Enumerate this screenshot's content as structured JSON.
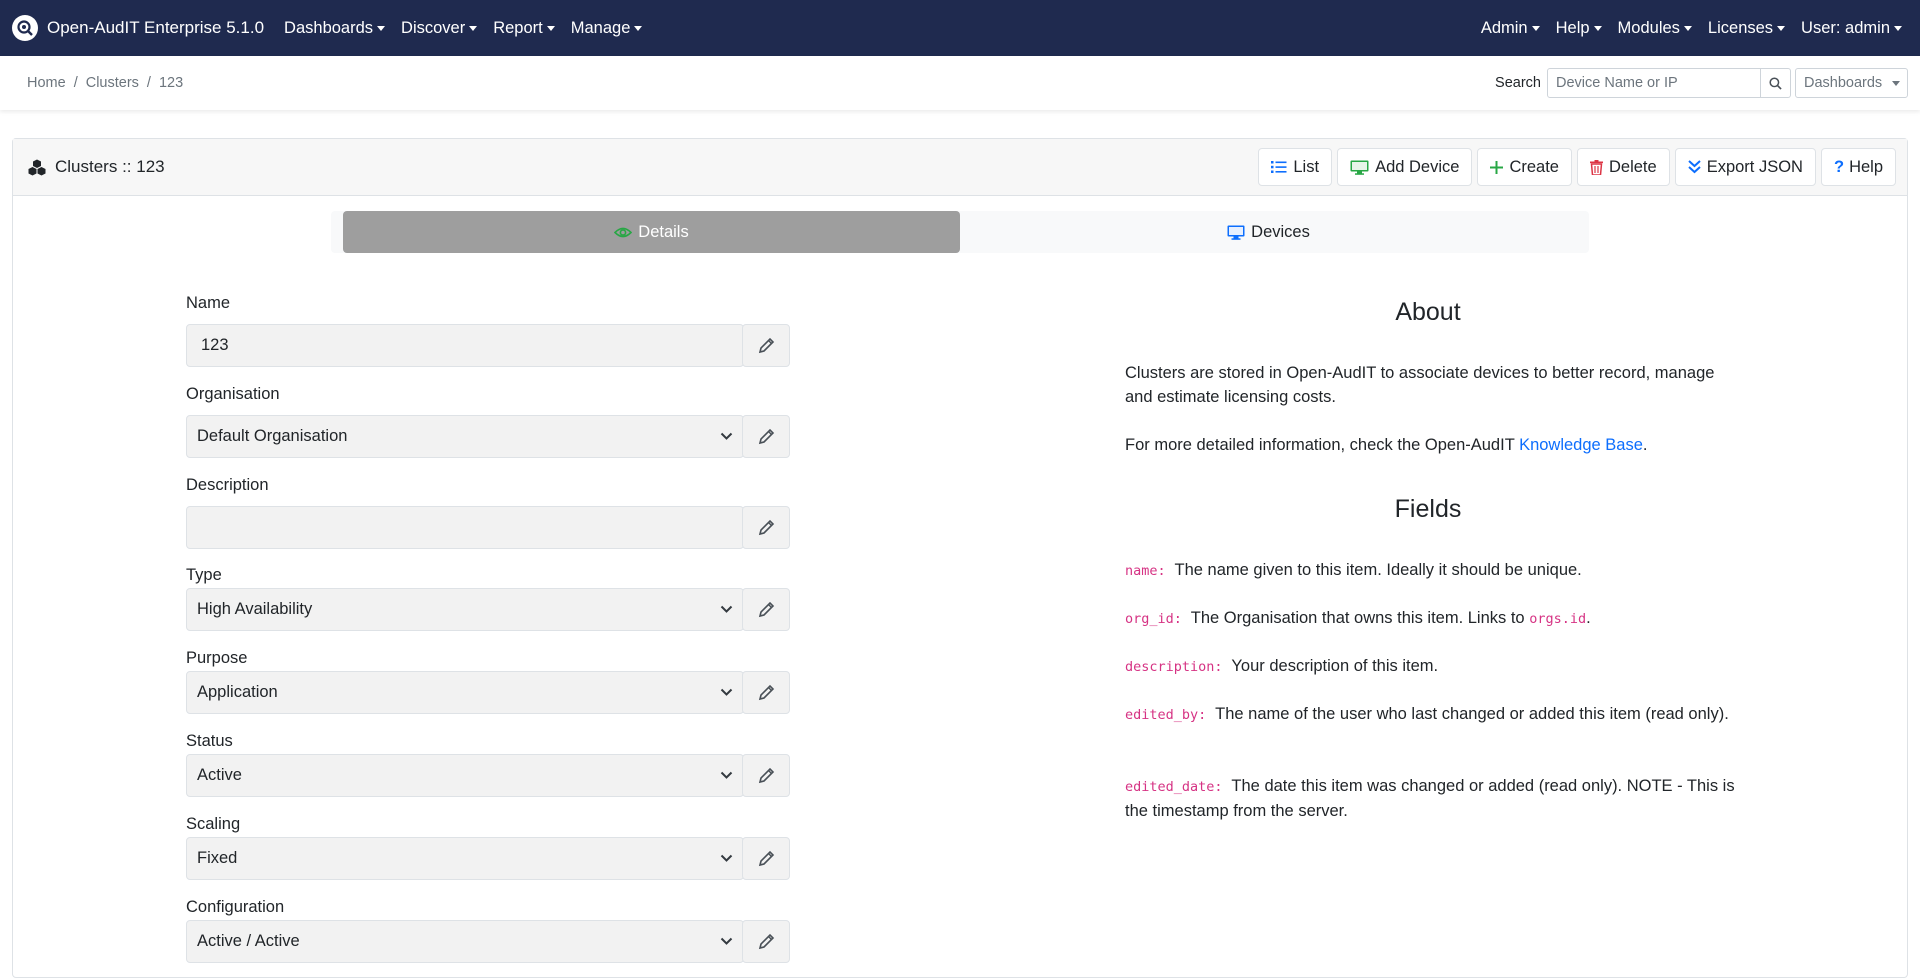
{
  "navbar": {
    "brand": "Open-AudIT Enterprise 5.1.0",
    "left_menu": [
      "Dashboards",
      "Discover",
      "Report",
      "Manage"
    ],
    "right_menu": [
      "Admin",
      "Help",
      "Modules",
      "Licenses",
      "User: admin"
    ],
    "background": "#1f2a4f"
  },
  "breadcrumb": {
    "items": [
      "Home",
      "Clusters",
      "123"
    ]
  },
  "search": {
    "label": "Search",
    "placeholder": "Device Name or IP",
    "dashboards_label": "Dashboards"
  },
  "card": {
    "title": "Clusters :: 123",
    "toolbar": {
      "list": "List",
      "add_device": "Add Device",
      "create": "Create",
      "delete": "Delete",
      "export_json": "Export JSON",
      "help": "Help"
    },
    "tabs": {
      "details": "Details",
      "devices": "Devices"
    }
  },
  "form": {
    "name": {
      "label": "Name",
      "value": "123"
    },
    "organisation": {
      "label": "Organisation",
      "value": "Default Organisation"
    },
    "description": {
      "label": "Description",
      "value": ""
    },
    "type": {
      "label": "Type",
      "value": "High Availability"
    },
    "purpose": {
      "label": "Purpose",
      "value": "Application"
    },
    "status": {
      "label": "Status",
      "value": "Active"
    },
    "scaling": {
      "label": "Scaling",
      "value": "Fixed"
    },
    "configuration": {
      "label": "Configuration",
      "value": "Active / Active"
    }
  },
  "about": {
    "heading": "About",
    "text": "Clusters are stored in Open-AudIT to associate devices to better record, manage and estimate licensing costs.",
    "more_info_prefix": "For more detailed information, check the Open-AudIT ",
    "kb_link": "Knowledge Base",
    "more_info_suffix": ".",
    "fields_heading": "Fields",
    "fields": {
      "name_key": "name:",
      "name_desc": "The name given to this item. Ideally it should be unique.",
      "org_key": "org_id:",
      "org_desc": "The Organisation that owns this item. Links to ",
      "org_link_code": "orgs.id",
      "org_desc_end": ".",
      "desc_key": "description:",
      "desc_desc": "Your description of this item.",
      "edited_by_key": "edited_by:",
      "edited_by_desc": "The name of the user who last changed or added this item (read only).",
      "edited_date_key": "edited_date:",
      "edited_date_desc": "The date this item was changed or added (read only). NOTE - This is the timestamp from the server."
    }
  },
  "colors": {
    "link": "#0d6efd",
    "code": "#d63384",
    "tab_active": "#9e9e9e"
  }
}
